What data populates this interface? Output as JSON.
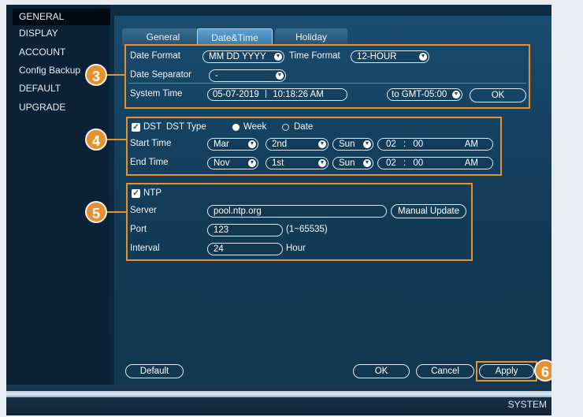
{
  "sidebar": {
    "items": [
      {
        "label": "GENERAL",
        "active": true
      },
      {
        "label": "DISPLAY"
      },
      {
        "label": "ACCOUNT"
      },
      {
        "label": "Config Backup"
      },
      {
        "label": "DEFAULT"
      },
      {
        "label": "UPGRADE"
      }
    ]
  },
  "tabs": [
    {
      "label": "General"
    },
    {
      "label": "Date&Time",
      "active": true
    },
    {
      "label": "Holiday"
    }
  ],
  "badges": [
    "3",
    "4",
    "5",
    "6"
  ],
  "date_section": {
    "date_format_label": "Date Format",
    "date_format_value": "MM DD YYYY",
    "time_format_label": "Time Format",
    "time_format_value": "12-HOUR",
    "date_separator_label": "Date Separator",
    "date_separator_value": "-",
    "system_time_label": "System Time",
    "system_date_value": "05-07-2019",
    "system_clock_value": "10:18:26 AM",
    "timezone_value": "to GMT-05:00",
    "ok_label": "OK"
  },
  "dst_section": {
    "dst_label": "DST",
    "dst_checked": true,
    "dst_type_label": "DST Type",
    "week_label": "Week",
    "date_label": "Date",
    "selected_type": "Week",
    "start_label": "Start Time",
    "start_month": "Mar",
    "start_week": "2nd",
    "start_day": "Sun",
    "start_hour": "02",
    "start_minute": "00",
    "start_ampm": "AM",
    "end_label": "End Time",
    "end_month": "Nov",
    "end_week": "1st",
    "end_day": "Sun",
    "end_hour": "02",
    "end_minute": "00",
    "end_ampm": "AM",
    "time_sep": ":"
  },
  "ntp_section": {
    "ntp_label": "NTP",
    "ntp_checked": true,
    "server_label": "Server",
    "server_value": "pool.ntp.org",
    "manual_update_label": "Manual Update",
    "port_label": "Port",
    "port_value": "123",
    "port_range": "(1~65535)",
    "interval_label": "Interval",
    "interval_value": "24",
    "interval_unit": "Hour"
  },
  "footer": {
    "default_label": "Default",
    "ok_label": "OK",
    "cancel_label": "Cancel",
    "apply_label": "Apply",
    "system_label": "SYSTEM"
  },
  "colors": {
    "callout": "#e9902e",
    "panel": "#1a4c70",
    "sidebar": "#0b2236"
  },
  "icons": {
    "dropdown": "chevron-down-icon",
    "checkbox": "check-icon"
  }
}
